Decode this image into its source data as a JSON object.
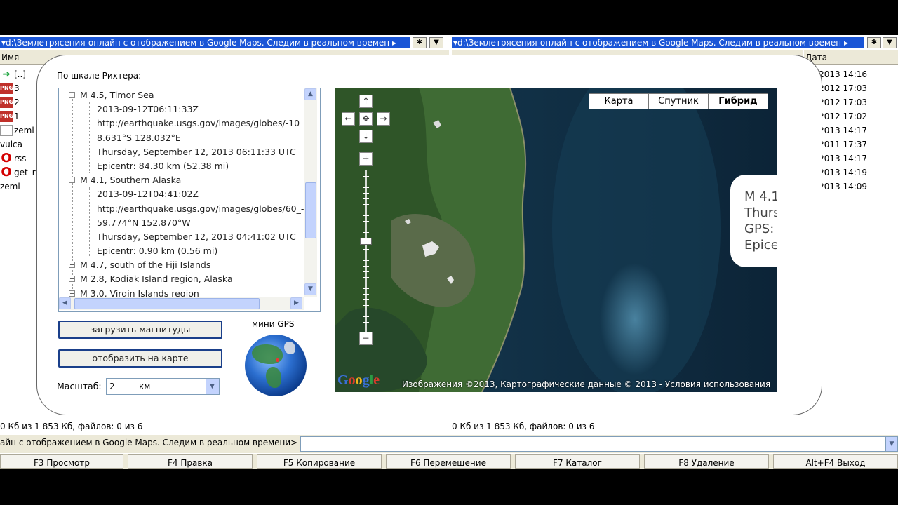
{
  "left_panel": {
    "path": "▾d:\\Землетрясения-онлайн с отображением в Google Maps. Следим в реальном времен ▸",
    "col_name": "Имя",
    "files": [
      {
        "icon": "up-arrow-icon",
        "name": "[..]"
      },
      {
        "icon": "png-icon",
        "name": "3"
      },
      {
        "icon": "png-icon",
        "name": "2"
      },
      {
        "icon": "png-icon",
        "name": "1"
      },
      {
        "icon": "document-icon",
        "name": "zeml_"
      },
      {
        "icon": "globe-app-icon",
        "name": "vulca"
      },
      {
        "icon": "opera-icon",
        "name": "rss"
      },
      {
        "icon": "opera-icon",
        "name": "get_r"
      },
      {
        "icon": "globe-app-icon",
        "name": "zeml_"
      }
    ],
    "status": "0 Кб из 1 853 Кб, файлов: 0 из 6"
  },
  "right_panel": {
    "path": "▾d:\\Землетрясения-онлайн с отображением в Google Maps. Следим в реальном времен ▸",
    "col_date": "Дата",
    "dates": [
      "09.2013 14:16",
      "03.2012 17:03",
      "03.2012 17:03",
      "03.2012 17:02",
      "09.2013 14:17",
      "09.2011 17:37",
      "09.2013 14:17",
      "09.2013 14:19",
      "09.2013 14:09"
    ],
    "status": "0 Кб из 1 853 Кб, файлов: 0 из 6"
  },
  "path_buttons": {
    "star": "✱",
    "dropdown": "▼"
  },
  "command_line": {
    "prompt": "айн с отображением в Google Maps. Следим в реальном времени>",
    "value": ""
  },
  "fkeys": [
    {
      "label": "F3 Просмотр"
    },
    {
      "label": "F4 Правка"
    },
    {
      "label": "F5 Копирование"
    },
    {
      "label": "F6 Перемещение"
    },
    {
      "label": "F7 Каталог"
    },
    {
      "label": "F8 Удаление"
    },
    {
      "label": "Alt+F4 Выход"
    }
  ],
  "dialog": {
    "richter_label": "По шкале Рихтера:",
    "tree": [
      {
        "level": 0,
        "expanded": true,
        "text": "M 4.5, Timor Sea"
      },
      {
        "level": 1,
        "text": "2013-09-12T06:11:33Z"
      },
      {
        "level": 1,
        "text": "http://earthquake.usgs.gov/images/globes/-10_"
      },
      {
        "level": 1,
        "text": "8.631°S 128.032°E"
      },
      {
        "level": 1,
        "text": "Thursday, September 12, 2013 06:11:33 UTC"
      },
      {
        "level": 1,
        "text": "Epicentr: 84.30 km (52.38 mi)"
      },
      {
        "level": 0,
        "expanded": true,
        "text": "M 4.1, Southern Alaska"
      },
      {
        "level": 1,
        "text": "2013-09-12T04:41:02Z"
      },
      {
        "level": 1,
        "text": "http://earthquake.usgs.gov/images/globes/60_-"
      },
      {
        "level": 1,
        "text": "59.774°N 152.870°W"
      },
      {
        "level": 1,
        "text": "Thursday, September 12, 2013 04:41:02 UTC"
      },
      {
        "level": 1,
        "text": "Epicentr: 0.90 km (0.56 mi)"
      },
      {
        "level": 0,
        "expanded": false,
        "text": "M 4.7, south of the Fiji Islands"
      },
      {
        "level": 0,
        "expanded": false,
        "text": "M 2.8, Kodiak Island region, Alaska"
      },
      {
        "level": 0,
        "expanded": false,
        "text": "M 3.0, Virgin Islands region"
      }
    ],
    "load_button": "загрузить магнитуды",
    "show_button": "отобразить на карте",
    "mini_gps_label": "мини GPS",
    "scale_label": "Масштаб:",
    "scale_value": "2",
    "scale_unit": "км",
    "map": {
      "types": [
        "Карта",
        "Спутник",
        "Гибрид"
      ],
      "active_type": "Гибрид",
      "info_lines": [
        "M 4.1",
        "Thurs",
        "GPS:",
        "Epice"
      ],
      "attribution": "Изображения ©2013, Картографические данные © 2013 - Условия использования",
      "logo": "Google"
    }
  }
}
